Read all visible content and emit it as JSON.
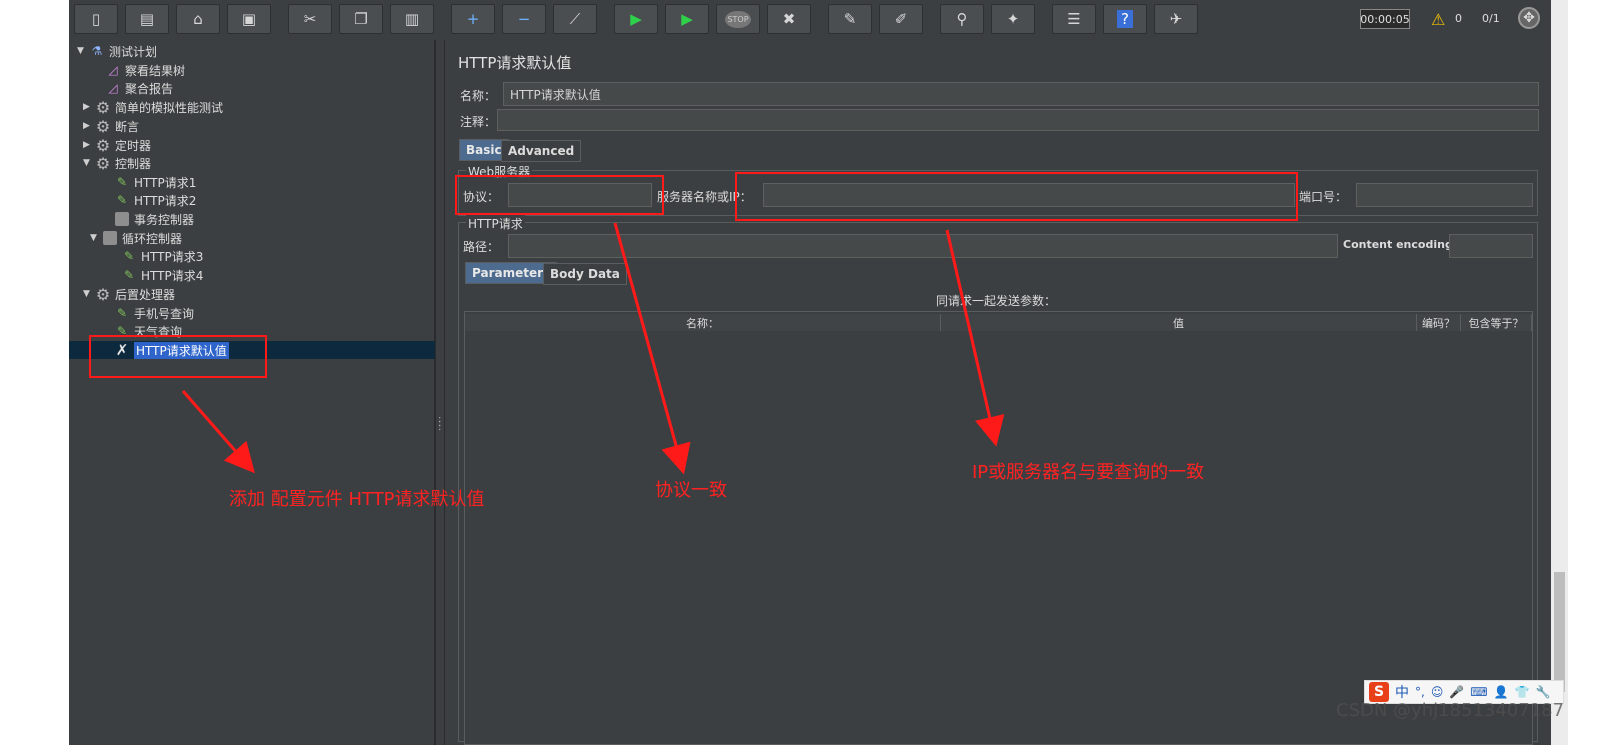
{
  "toolbar": {
    "buttons": [
      {
        "name": "new-icon",
        "glyph": "▯"
      },
      {
        "name": "templates-icon",
        "glyph": "▤"
      },
      {
        "name": "open-icon",
        "glyph": "⌂"
      },
      {
        "name": "save-icon",
        "glyph": "▣"
      },
      {
        "name": "cut-icon",
        "glyph": "✂"
      },
      {
        "name": "copy-icon",
        "glyph": "❐"
      },
      {
        "name": "paste-icon",
        "glyph": "▥"
      },
      {
        "name": "expand-icon",
        "glyph": "+"
      },
      {
        "name": "collapse-icon",
        "glyph": "−"
      },
      {
        "name": "toggle-icon",
        "glyph": "⟋"
      },
      {
        "name": "start-icon",
        "glyph": "▶"
      },
      {
        "name": "start-no-pause-icon",
        "glyph": "▶"
      },
      {
        "name": "stop-icon",
        "glyph": "STOP"
      },
      {
        "name": "shutdown-icon",
        "glyph": "✖"
      },
      {
        "name": "clear-icon",
        "glyph": "✎"
      },
      {
        "name": "clear-all-icon",
        "glyph": "✐"
      },
      {
        "name": "search-icon",
        "glyph": "⚲"
      },
      {
        "name": "reset-search-icon",
        "glyph": "✦"
      },
      {
        "name": "function-helper-icon",
        "glyph": "☰"
      },
      {
        "name": "help-icon",
        "glyph": "?"
      },
      {
        "name": "remote-icon",
        "glyph": "✈"
      }
    ],
    "timer": "00:00:05",
    "warning_count": "0",
    "threads": "0/1"
  },
  "tree": {
    "nodes": [
      {
        "label": "测试计划",
        "icon": "flask-icon",
        "toggle": "▼"
      },
      {
        "label": "察看结果树",
        "icon": "graph-icon",
        "toggle": ""
      },
      {
        "label": "聚合报告",
        "icon": "graph-icon",
        "toggle": ""
      },
      {
        "label": "简单的模拟性能测试",
        "icon": "gear-icon",
        "toggle": "▶"
      },
      {
        "label": "断言",
        "icon": "gear-icon",
        "toggle": "▶"
      },
      {
        "label": "定时器",
        "icon": "gear-icon",
        "toggle": "▶"
      },
      {
        "label": "控制器",
        "icon": "gear-icon",
        "toggle": "▼"
      },
      {
        "label": "HTTP请求1",
        "icon": "sampler-icon",
        "toggle": ""
      },
      {
        "label": "HTTP请求2",
        "icon": "sampler-icon",
        "toggle": ""
      },
      {
        "label": "事务控制器",
        "icon": "controller-icon",
        "toggle": ""
      },
      {
        "label": "循环控制器",
        "icon": "controller-icon",
        "toggle": "▼"
      },
      {
        "label": "HTTP请求3",
        "icon": "sampler-icon",
        "toggle": ""
      },
      {
        "label": "HTTP请求4",
        "icon": "sampler-icon",
        "toggle": ""
      },
      {
        "label": "后置处理器",
        "icon": "gear-icon",
        "toggle": "▼"
      },
      {
        "label": "手机号查询",
        "icon": "sampler-icon",
        "toggle": ""
      },
      {
        "label": "天气查询",
        "icon": "sampler-icon",
        "toggle": ""
      },
      {
        "label": "HTTP请求默认值",
        "icon": "config-tools-icon",
        "toggle": ""
      }
    ]
  },
  "panel": {
    "title": "HTTP请求默认值",
    "name_label": "名称：",
    "name_value": "HTTP请求默认值",
    "comment_label": "注释：",
    "comment_value": "",
    "tabs": [
      "Basic",
      "Advanced"
    ],
    "web_server_group": "Web服务器",
    "protocol_label": "协议：",
    "protocol_value": "",
    "server_label": "服务器名称或IP：",
    "server_value": "",
    "port_label": "端口号：",
    "port_value": "",
    "http_request_group": "HTTP请求",
    "path_label": "路径：",
    "path_value": "",
    "encoding_label": "Content encoding:",
    "encoding_value": "",
    "subtabs": [
      "Parameters",
      "Body Data"
    ],
    "params_caption": "同请求一起发送参数：",
    "columns": [
      "名称：",
      "值",
      "编码？",
      "包含等于？"
    ]
  },
  "annotations": {
    "add_config": "添加  配置元件  HTTP请求默认值",
    "protocol_note": "协议一致",
    "server_note": "IP或服务器名与要查询的一致"
  },
  "overlay": {
    "ime_label": "中",
    "ime_glyphs": [
      "°,",
      "☺",
      "🎤",
      "⌨",
      "👤",
      "👕",
      "🔧"
    ],
    "watermark": "CSDN @yhj18513407187"
  },
  "colors": {
    "background": "#3c3f41",
    "selection": "#2f65ca",
    "annotation": "#ff1a1a",
    "tab_active": "#4c6b8f"
  }
}
